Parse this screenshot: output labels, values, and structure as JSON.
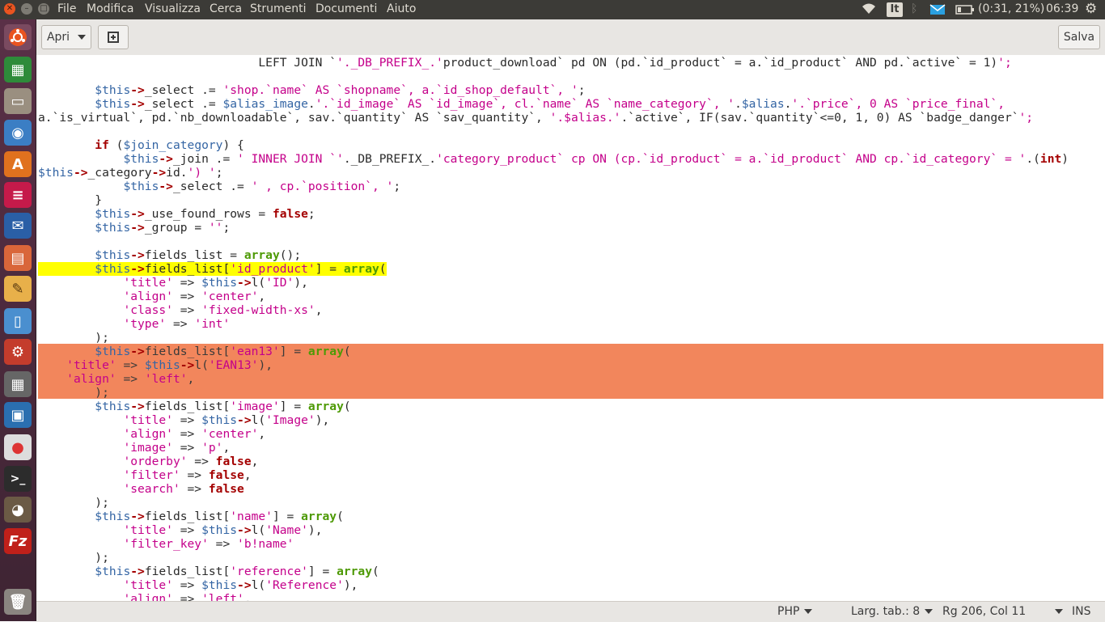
{
  "topbar": {
    "menu": [
      "File",
      "Modifica",
      "Visualizza",
      "Cerca",
      "Strumenti",
      "Documenti",
      "Aiuto"
    ],
    "keyboard_layout": "It",
    "battery": "(0:31, 21%)",
    "clock": "06:39"
  },
  "launcher": {
    "items": [
      "dash",
      "libreoffice-calc",
      "files",
      "chromium",
      "software-center",
      "app-red",
      "thunderbird",
      "document-viewer",
      "text-editor",
      "document-app",
      "system-settings",
      "calculator",
      "remote-app",
      "chrome",
      "terminal",
      "gimp",
      "filezilla",
      "trash"
    ]
  },
  "toolbar": {
    "open_label": "Apri",
    "save_label": "Salva"
  },
  "editor": {
    "lines": [
      "                               LEFT JOIN `'._DB_PREFIX_.'product_download` pd ON (pd.`id_product` = a.`id_product` AND pd.`active` = 1)';",
      "",
      "        $this->_select .= 'shop.`name` AS `shopname`, a.`id_shop_default`, ';",
      "        $this->_select .= $alias_image.'.`id_image` AS `id_image`, cl.`name` AS `name_category`, '.$alias.'.`price`, 0 AS `price_final`,",
      "a.`is_virtual`, pd.`nb_downloadable`, sav.`quantity` AS `sav_quantity`, '.$alias.'.`active`, IF(sav.`quantity`<=0, 1, 0) AS `badge_danger`';",
      "",
      "        if ($join_category) {",
      "            $this->_join .= ' INNER JOIN `'._DB_PREFIX_.'category_product` cp ON (cp.`id_product` = a.`id_product` AND cp.`id_category` = '.(int)",
      "$this->_category->id.') ';",
      "            $this->_select .= ' , cp.`position`, ';",
      "        }",
      "        $this->_use_found_rows = false;",
      "        $this->_group = '';",
      "",
      "        $this->fields_list = array();",
      "        $this->fields_list['id_product'] = array(",
      "            'title' => $this->l('ID'),",
      "            'align' => 'center',",
      "            'class' => 'fixed-width-xs',",
      "            'type' => 'int'",
      "        );",
      "        $this->fields_list['ean13'] = array(",
      "    'title' => $this->l('EAN13'),",
      "    'align' => 'left',",
      "        );",
      "        $this->fields_list['image'] = array(",
      "            'title' => $this->l('Image'),",
      "            'align' => 'center',",
      "            'image' => 'p',",
      "            'orderby' => false,",
      "            'filter' => false,",
      "            'search' => false",
      "        );",
      "        $this->fields_list['name'] = array(",
      "            'title' => $this->l('Name'),",
      "            'filter_key' => 'b!name'",
      "        );",
      "        $this->fields_list['reference'] = array(",
      "            'title' => $this->l('Reference'),",
      "            'align' => 'left',"
    ]
  },
  "statusbar": {
    "language": "PHP",
    "tab_width": "Larg. tab.: 8",
    "position": "Rg 206, Col 11",
    "mode": "INS"
  }
}
